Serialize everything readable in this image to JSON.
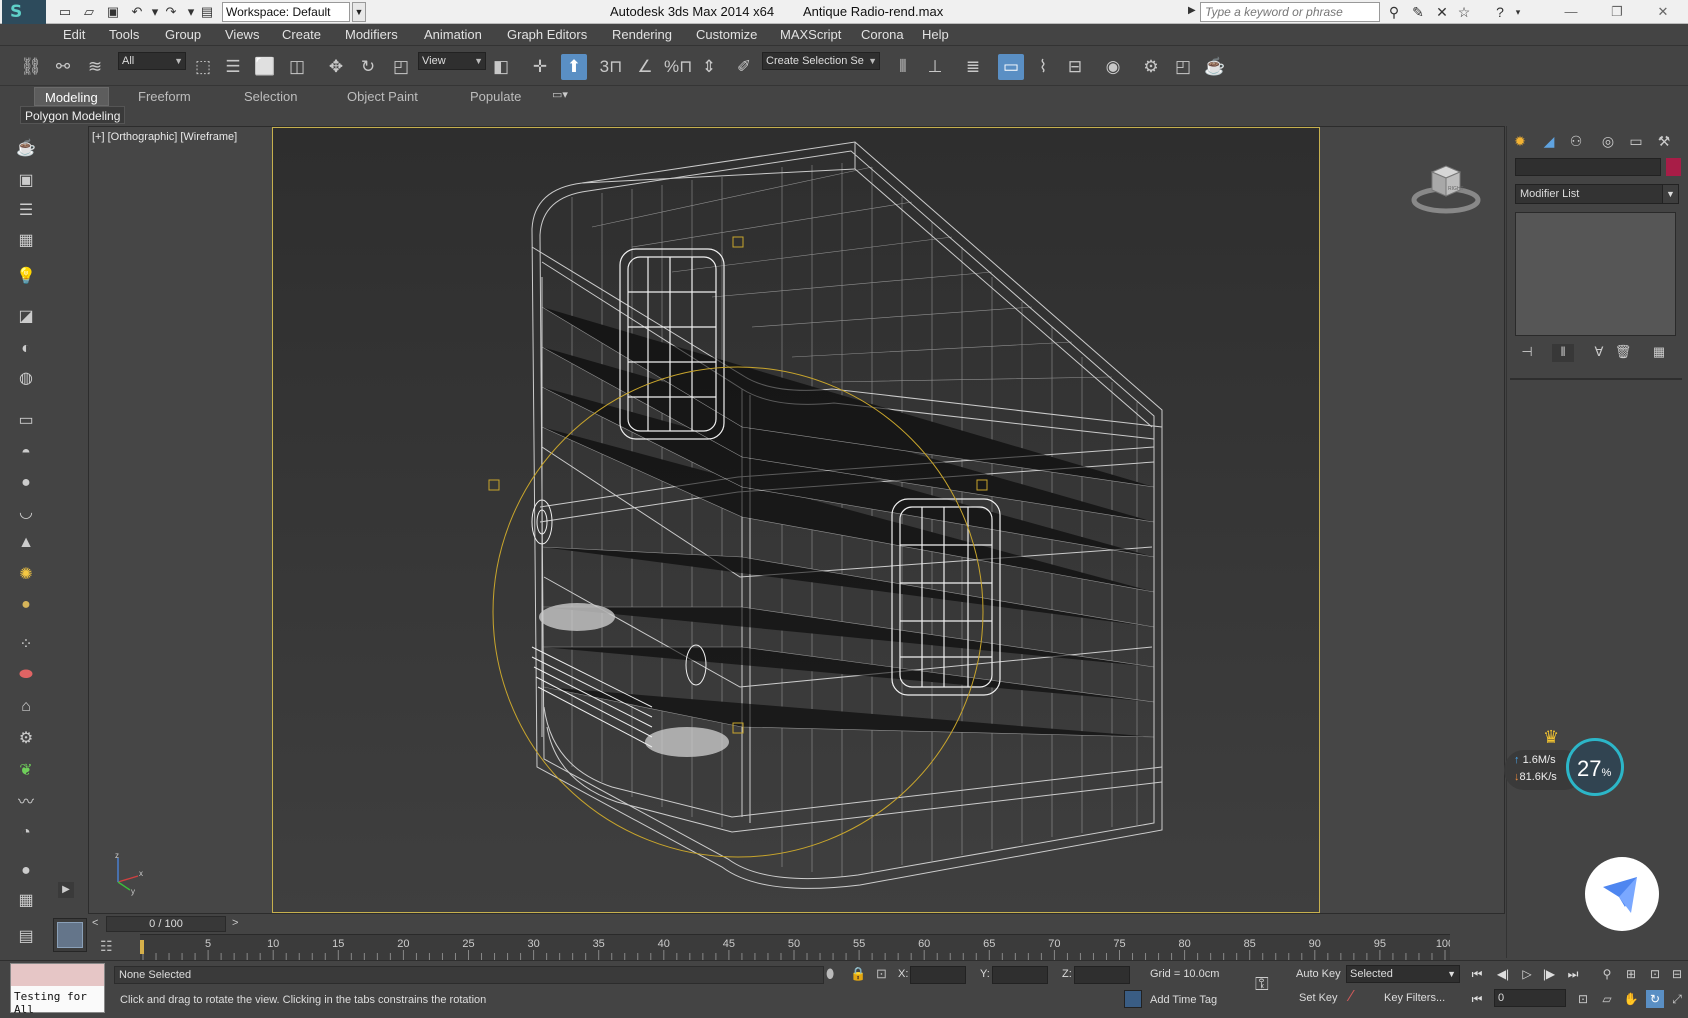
{
  "titlebar": {
    "workspace": "Workspace: Default",
    "app_title": "Autodesk 3ds Max  2014 x64",
    "doc_title": "Antique Radio-rend.max",
    "search_placeholder": "Type a keyword or phrase"
  },
  "menu": [
    "Edit",
    "Tools",
    "Group",
    "Views",
    "Create",
    "Modifiers",
    "Animation",
    "Graph Editors",
    "Rendering",
    "Customize",
    "MAXScript",
    "Corona",
    "Help"
  ],
  "toolbar": {
    "selection_filter": "All",
    "reference_coord": "View",
    "named_selection": "Create Selection Se",
    "snap_labels": [
      "3",
      "%"
    ]
  },
  "ribbon": {
    "tabs": [
      "Modeling",
      "Freeform",
      "Selection",
      "Object Paint",
      "Populate"
    ],
    "active_tab": "Modeling",
    "sub_label": "Polygon Modeling"
  },
  "viewport": {
    "label": "[+] [Orthographic] [Wireframe]",
    "viewcube_face": "RIGHT",
    "axes": [
      "x",
      "y",
      "z"
    ]
  },
  "command_panel": {
    "modifier_list": "Modifier List",
    "object_color": "#a81d47"
  },
  "net_widget": {
    "upload": "1.6M/s",
    "download": "81.6K/s",
    "percent": "27",
    "percent_unit": "%"
  },
  "timeline": {
    "frame_readout": "0 / 100",
    "prev": "<",
    "next": ">",
    "ticks": [
      "5",
      "10",
      "15",
      "20",
      "25",
      "30",
      "35",
      "40",
      "45",
      "50",
      "55",
      "60",
      "65",
      "70",
      "75",
      "80",
      "85",
      "90",
      "95",
      "100"
    ]
  },
  "statusbar": {
    "maxscript_text": "Testing for All",
    "selection": "None Selected",
    "prompt": "Click and drag to rotate the view.  Clicking in the tabs constrains the rotation",
    "x_label": "X:",
    "y_label": "Y:",
    "z_label": "Z:",
    "grid": "Grid = 10.0cm",
    "add_time_tag": "Add Time Tag",
    "auto_key": "Auto Key",
    "set_key": "Set Key",
    "key_mode": "Selected",
    "key_filters": "Key Filters...",
    "frame": "0"
  },
  "colors": {
    "ui_bg": "#444444",
    "viewport_frame": "#c6b04e",
    "wire": "#e6e6e6",
    "gizmo": "#c8a52c"
  }
}
